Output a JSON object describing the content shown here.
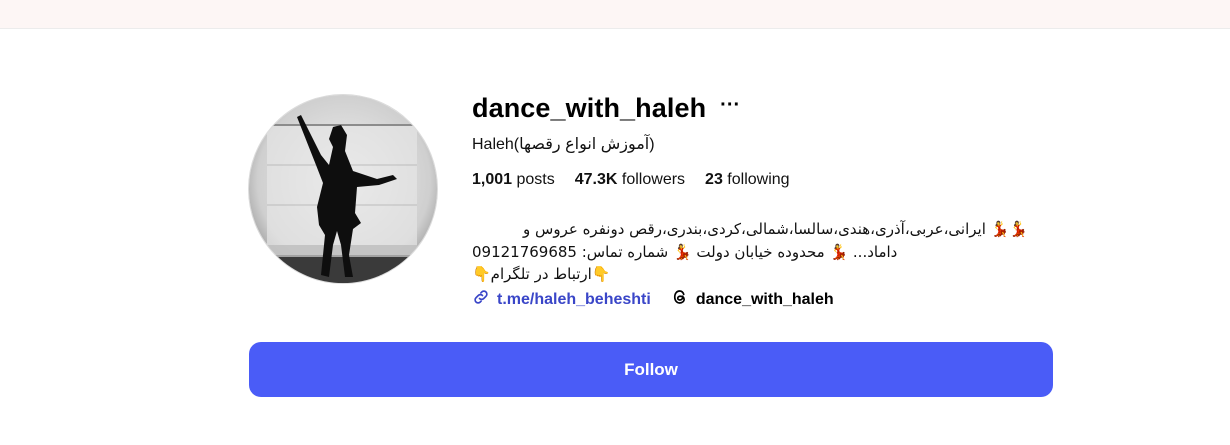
{
  "profile": {
    "username": "dance_with_haleh",
    "more_label": "···",
    "full_name": "Haleh(آموزش انواع رقصها)"
  },
  "stats": {
    "posts_count": "1,001",
    "posts_label": "posts",
    "followers_count": "47.3K",
    "followers_label": "followers",
    "following_count": "23",
    "following_label": "following"
  },
  "bio": {
    "line1": "💃💃 ایرانی،عربی،آذری،هندی،سالسا،شمالی،کردی،بندری،رقص دونفره عروس و",
    "line2": "داماد... 💃 محدوده خیابان دولت 💃 شماره تماس: 09121769685",
    "line3": "👇ارتباط در تلگرام👇"
  },
  "links": {
    "website": "t.me/haleh_beheshti",
    "threads": "dance_with_haleh"
  },
  "actions": {
    "follow_label": "Follow"
  },
  "icons": {
    "link": "link-icon",
    "threads": "threads-icon",
    "more": "more-options-icon"
  },
  "colors": {
    "accent": "#4a5cf7",
    "link": "#3a46c8",
    "topbar": "#fdf6f5"
  }
}
